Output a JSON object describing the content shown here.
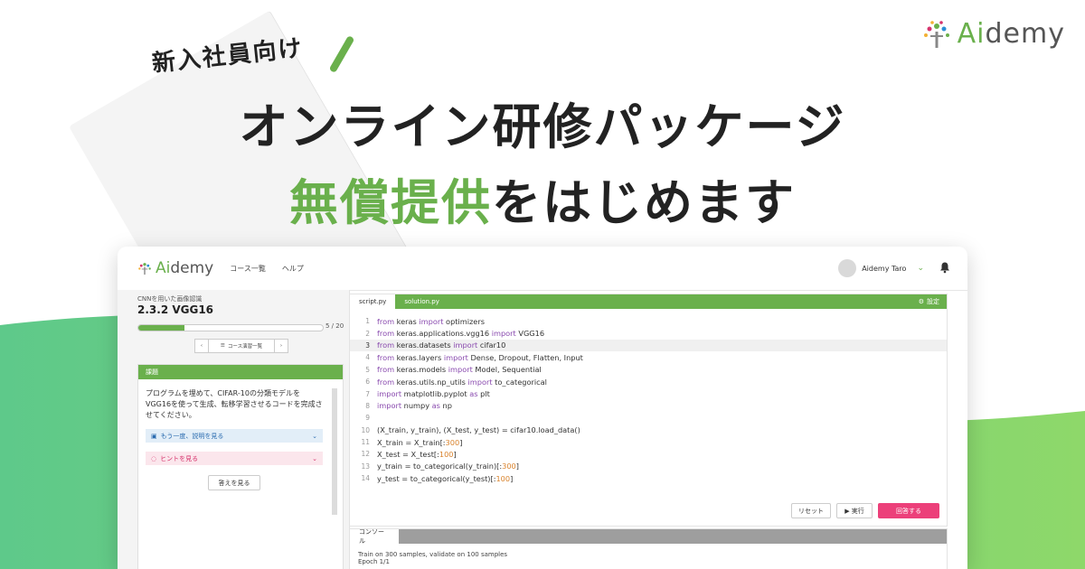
{
  "brand": {
    "name_prefix": "Ai",
    "name_suffix": "demy",
    "primary_color": "#6ab04c"
  },
  "headline": {
    "tagline": "新入社員向け",
    "line1": "オンライン研修パッケージ",
    "line2_highlight": "無償提供",
    "line2_rest": "をはじめます"
  },
  "app": {
    "logo_prefix": "Ai",
    "logo_suffix": "demy",
    "nav": [
      "コース一覧",
      "ヘルプ"
    ],
    "user_name": "Aidemy Taro",
    "sidebar": {
      "course_title": "CNNを用いた画像認識",
      "lesson_title": "2.3.2 VGG16",
      "progress": {
        "current": 5,
        "total": 20,
        "label": "5 / 20"
      },
      "pager": {
        "prev": "‹",
        "list": "コース演習一覧",
        "next": "›"
      },
      "task_heading": "課題",
      "task_text": "プログラムを埋めて、CIFAR-10の分類モデルをVGG16を使って生成、転移学習させるコードを完成させてください。",
      "explain_label": "もう一度、説明を見る",
      "hint_label": "ヒントを見る",
      "answer_label": "答えを見る"
    },
    "editor": {
      "tabs": [
        "script.py",
        "solution.py"
      ],
      "active_tab": 0,
      "settings_label": "設定",
      "highlighted_line": 3,
      "lines": [
        [
          [
            "kw",
            "from"
          ],
          [
            "t",
            " keras "
          ],
          [
            "kw",
            "import"
          ],
          [
            "t",
            " optimizers"
          ]
        ],
        [
          [
            "kw",
            "from"
          ],
          [
            "t",
            " keras.applications.vgg16 "
          ],
          [
            "kw",
            "import"
          ],
          [
            "t",
            " VGG16"
          ]
        ],
        [
          [
            "kw",
            "from"
          ],
          [
            "t",
            " keras.datasets "
          ],
          [
            "kw",
            "import"
          ],
          [
            "t",
            " cifar10"
          ]
        ],
        [
          [
            "kw",
            "from"
          ],
          [
            "t",
            " keras.layers "
          ],
          [
            "kw",
            "import"
          ],
          [
            "t",
            " Dense, Dropout, Flatten, Input"
          ]
        ],
        [
          [
            "kw",
            "from"
          ],
          [
            "t",
            " keras.models "
          ],
          [
            "kw",
            "import"
          ],
          [
            "t",
            " Model, Sequential"
          ]
        ],
        [
          [
            "kw",
            "from"
          ],
          [
            "t",
            " keras.utils.np_utils "
          ],
          [
            "kw",
            "import"
          ],
          [
            "t",
            " to_categorical"
          ]
        ],
        [
          [
            "kw",
            "import"
          ],
          [
            "t",
            " matplotlib.pyplot "
          ],
          [
            "kw",
            "as"
          ],
          [
            "t",
            " plt"
          ]
        ],
        [
          [
            "kw",
            "import"
          ],
          [
            "t",
            " numpy "
          ],
          [
            "kw",
            "as"
          ],
          [
            "t",
            " np"
          ]
        ],
        [],
        [
          [
            "t",
            "(X_train, y_train), (X_test, y_test) = cifar10.load_data()"
          ]
        ],
        [
          [
            "t",
            "X_train = X_train[:"
          ],
          [
            "num",
            "300"
          ],
          [
            "t",
            "]"
          ]
        ],
        [
          [
            "t",
            "X_test = X_test[:"
          ],
          [
            "num",
            "100"
          ],
          [
            "t",
            "]"
          ]
        ],
        [
          [
            "t",
            "y_train = to_categorical(y_train)[:"
          ],
          [
            "num",
            "300"
          ],
          [
            "t",
            "]"
          ]
        ],
        [
          [
            "t",
            "y_test = to_categorical(y_test)[:"
          ],
          [
            "num",
            "100"
          ],
          [
            "t",
            "]"
          ]
        ]
      ],
      "reset_label": "リセット",
      "run_label": "▶ 実行",
      "submit_label": "回答する",
      "submit_color": "#ec407a"
    },
    "console": {
      "tab_label": "コンソール",
      "lines": [
        "Train on 300 samples, validate on 100 samples",
        "Epoch 1/1"
      ]
    }
  }
}
